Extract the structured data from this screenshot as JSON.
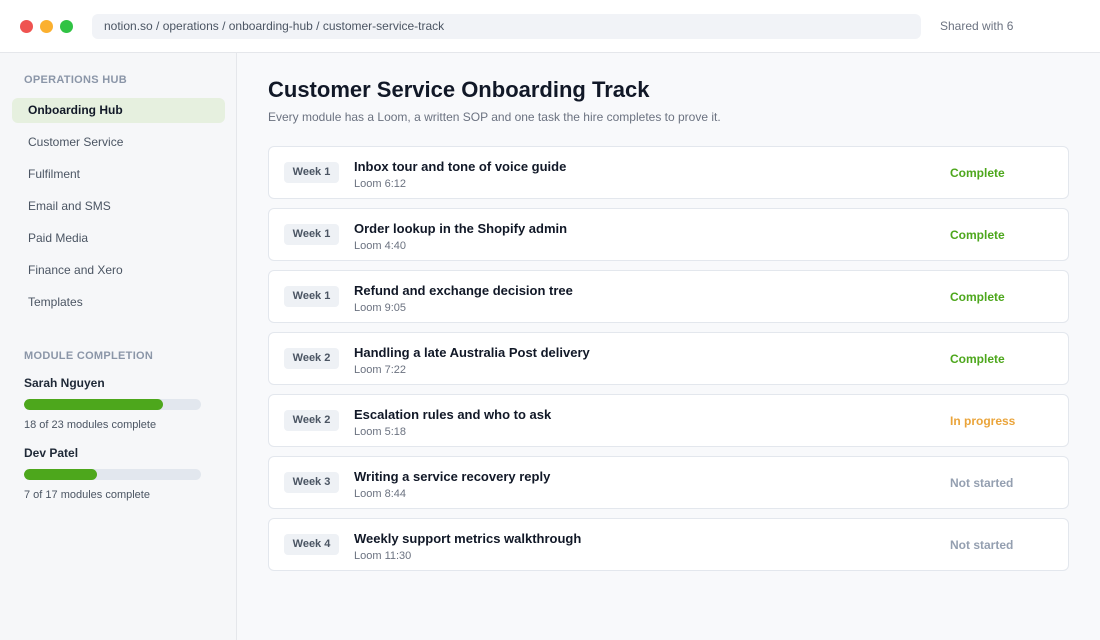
{
  "window": {
    "url": "notion.so / operations / onboarding-hub / customer-service-track",
    "shared": "Shared with 6"
  },
  "sidebar": {
    "section_title": "OPERATIONS HUB",
    "items": [
      {
        "label": "Onboarding Hub",
        "active": true
      },
      {
        "label": "Customer Service",
        "active": false
      },
      {
        "label": "Fulfilment",
        "active": false
      },
      {
        "label": "Email and SMS",
        "active": false
      },
      {
        "label": "Paid Media",
        "active": false
      },
      {
        "label": "Finance and Xero",
        "active": false
      },
      {
        "label": "Templates",
        "active": false
      }
    ],
    "completion_title": "MODULE COMPLETION",
    "people": [
      {
        "name": "Sarah Nguyen",
        "done": 18,
        "total": 23,
        "caption": "18 of 23 modules complete"
      },
      {
        "name": "Dev Patel",
        "done": 7,
        "total": 17,
        "caption": "7 of 17 modules complete"
      }
    ]
  },
  "main": {
    "title": "Customer Service Onboarding Track",
    "subtitle": "Every module has a Loom, a written SOP and one task the hire completes to prove it.",
    "modules": [
      {
        "week": "Week 1",
        "title": "Inbox tour and tone of voice guide",
        "meta": "Loom 6:12",
        "status": "Complete",
        "status_color": "#4da71c"
      },
      {
        "week": "Week 1",
        "title": "Order lookup in the Shopify admin",
        "meta": "Loom 4:40",
        "status": "Complete",
        "status_color": "#4da71c"
      },
      {
        "week": "Week 1",
        "title": "Refund and exchange decision tree",
        "meta": "Loom 9:05",
        "status": "Complete",
        "status_color": "#4da71c"
      },
      {
        "week": "Week 2",
        "title": "Handling a late Australia Post delivery",
        "meta": "Loom 7:22",
        "status": "Complete",
        "status_color": "#4da71c"
      },
      {
        "week": "Week 2",
        "title": "Escalation rules and who to ask",
        "meta": "Loom 5:18",
        "status": "In progress",
        "status_color": "#eaa43a"
      },
      {
        "week": "Week 3",
        "title": "Writing a service recovery reply",
        "meta": "Loom 8:44",
        "status": "Not started",
        "status_color": "#949fb0"
      },
      {
        "week": "Week 4",
        "title": "Weekly support metrics walkthrough",
        "meta": "Loom 11:30",
        "status": "Not started",
        "status_color": "#949fb0"
      }
    ]
  }
}
